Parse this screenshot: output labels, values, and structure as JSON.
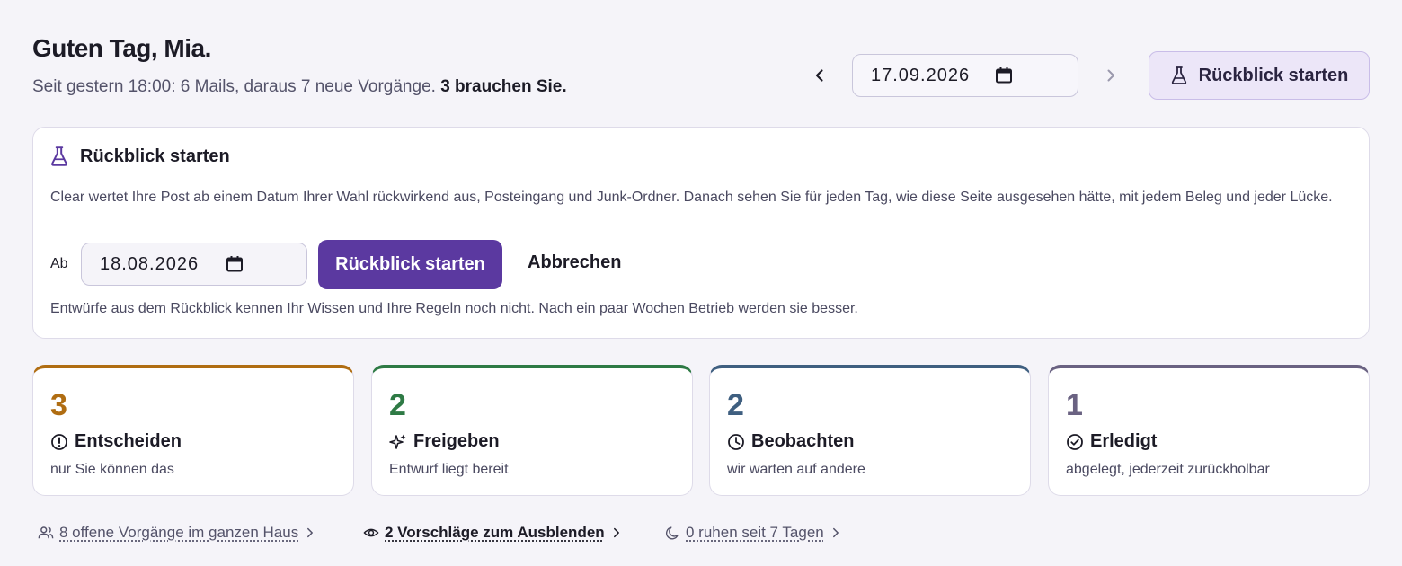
{
  "header": {
    "greeting": "Guten Tag, Mia.",
    "summary_prefix": "Seit gestern 18:00: 6 Mails, daraus 7 neue Vorgänge.",
    "summary_emphasis": "3 brauchen Sie."
  },
  "date_nav": {
    "current_date": "17.09.2026",
    "prev_icon": "chevron-left-icon",
    "next_icon": "chevron-right-icon"
  },
  "top_button": {
    "label": "Rückblick starten",
    "icon": "flask-icon"
  },
  "retro_panel": {
    "title": "Rückblick starten",
    "description": "Clear wertet Ihre Post ab einem Datum Ihrer Wahl rückwirkend aus, Posteingang und Junk-Ordner. Danach sehen Sie für jeden Tag, wie diese Seite ausgesehen hätte, mit jedem Beleg und jeder Lücke.",
    "from_label": "Ab",
    "from_date": "18.08.2026",
    "start_label": "Rückblick starten",
    "cancel_label": "Abbrechen",
    "hint": "Entwürfe aus dem Rückblick kennen Ihr Wissen und Ihre Regeln noch nicht. Nach ein paar Wochen Betrieb werden sie besser."
  },
  "cards": [
    {
      "count": "3",
      "label": "Entscheiden",
      "sub": "nur Sie können das",
      "color": "#b06d12",
      "icon": "alert-circle-icon"
    },
    {
      "count": "2",
      "label": "Freigeben",
      "sub": "Entwurf liegt bereit",
      "color": "#2e7a45",
      "icon": "sparkles-icon"
    },
    {
      "count": "2",
      "label": "Beobachten",
      "sub": "wir warten auf andere",
      "color": "#3f5f80",
      "icon": "clock-icon"
    },
    {
      "count": "1",
      "label": "Erledigt",
      "sub": "abgelegt, jederzeit zurückholbar",
      "color": "#6a6282",
      "icon": "check-circle-icon"
    }
  ],
  "footer_links": [
    {
      "label": "8 offene Vorgänge im ganzen Haus",
      "icon": "users-icon"
    },
    {
      "label": "2 Vorschläge zum Ausblenden",
      "icon": "eye-icon"
    },
    {
      "label": "0 ruhen seit 7 Tagen",
      "icon": "moon-icon"
    }
  ]
}
